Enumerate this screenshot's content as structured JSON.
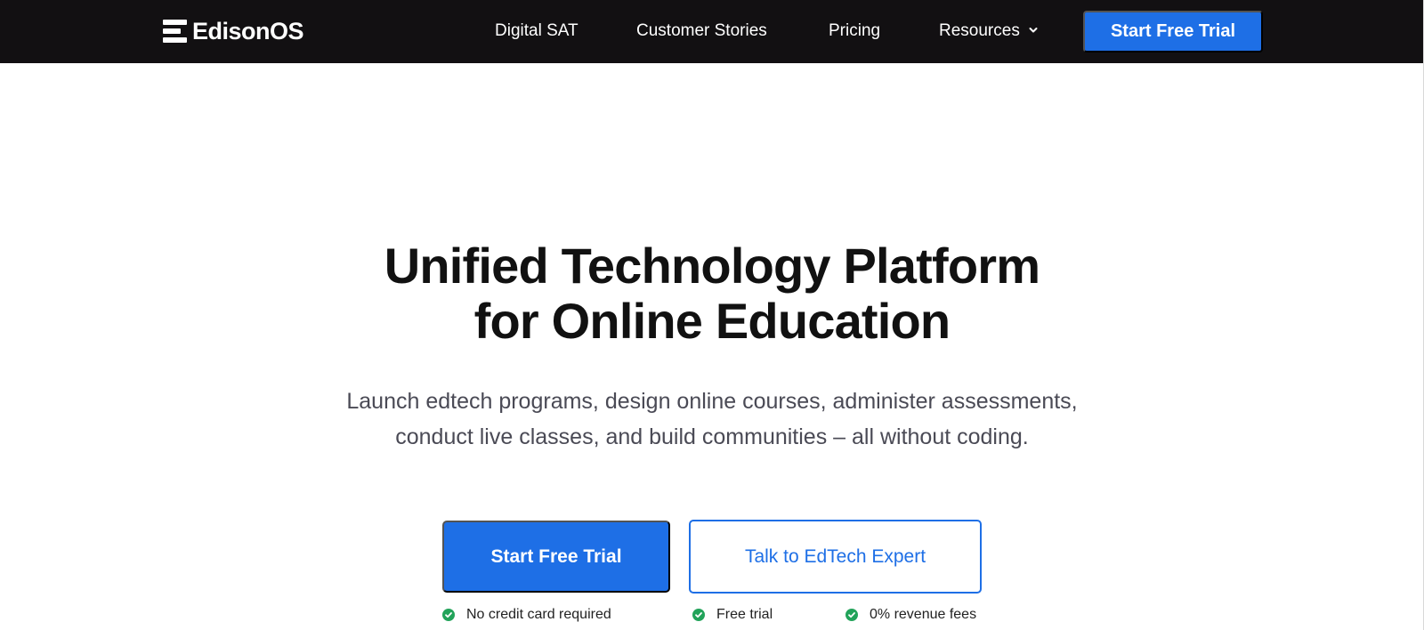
{
  "nav": {
    "logo_text": "EdisonOS",
    "links": [
      "Digital SAT",
      "Customer Stories",
      "Pricing"
    ],
    "resources_label": "Resources",
    "cta_label": "Start Free Trial"
  },
  "hero": {
    "title_line1": "Unified Technology Platform",
    "title_line2": "for Online Education",
    "subtitle_line1": "Launch edtech programs, design online courses, administer assessments,",
    "subtitle_line2": "conduct live classes, and build communities – all without coding.",
    "primary_cta": "Start Free Trial",
    "secondary_cta": "Talk to EdTech Expert",
    "features": [
      "No credit card required",
      "Free trial",
      "0% revenue fees"
    ]
  },
  "colors": {
    "nav_bg": "#121012",
    "accent_blue": "#1e6fe6",
    "check_green": "#22a35a"
  },
  "icons": {
    "logo": "stacked-bars-logo-icon",
    "dropdown": "chevron-down-icon",
    "feature_check": "check-circle-icon"
  }
}
